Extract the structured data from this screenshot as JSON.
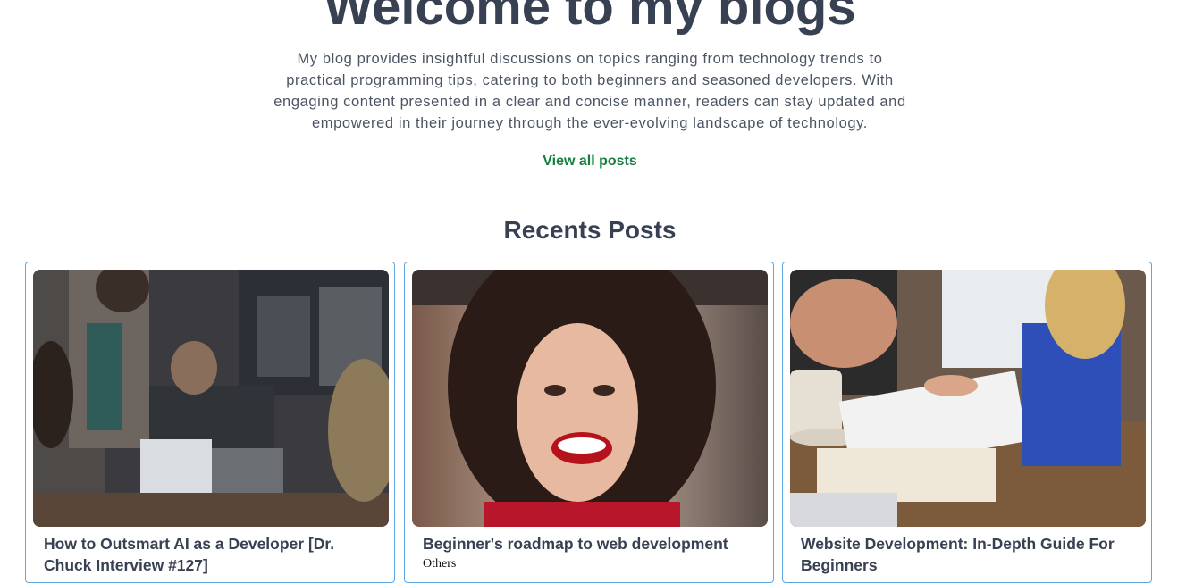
{
  "hero": {
    "title": "Welcome to my blogs",
    "description": "My blog provides insightful discussions on topics ranging from technology trends to practical programming tips, catering to both beginners and seasoned developers. With engaging content presented in a clear and concise manner, readers can stay updated and empowered in their journey through the ever-evolving landscape of technology.",
    "view_all_label": "View all posts"
  },
  "recent": {
    "heading": "Recents Posts",
    "posts": [
      {
        "title": "How to Outsmart AI as a Developer [Dr. Chuck Interview #127]",
        "category": "",
        "image": "office-meeting-photo"
      },
      {
        "title": "Beginner's roadmap to web development",
        "category": "Others",
        "image": "smiling-woman-photo"
      },
      {
        "title": "Website Development: In-Depth Guide For Beginners",
        "category": "",
        "image": "desk-notebook-photo"
      }
    ]
  },
  "colors": {
    "accent_green": "#15803d",
    "card_border": "#60a5e0",
    "heading": "#374151"
  }
}
